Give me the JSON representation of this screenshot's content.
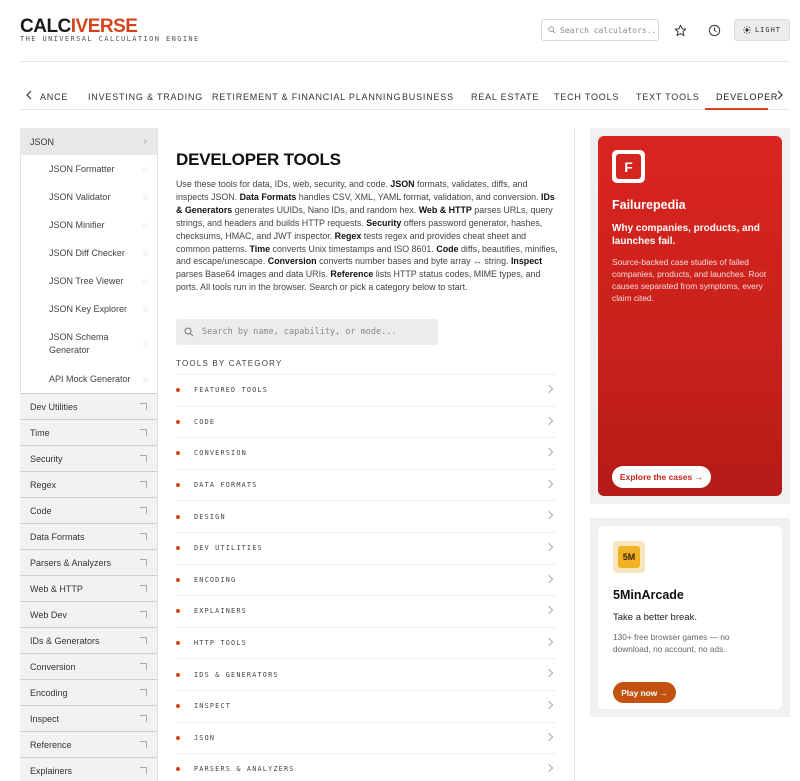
{
  "header": {
    "logo_part1": "CALC",
    "logo_part2": "IVERSE",
    "tagline": "THE UNIVERSAL CALCULATION ENGINE",
    "search_placeholder": "Search calculators...",
    "theme_label": "LIGHT",
    "icons": [
      "search-icon",
      "star-icon",
      "clock-icon",
      "sun-icon"
    ]
  },
  "tabs": {
    "items": [
      {
        "label": "ANCE"
      },
      {
        "label": "INVESTING & TRADING"
      },
      {
        "label": "RETIREMENT & FINANCIAL PLANNING"
      },
      {
        "label": "BUSINESS"
      },
      {
        "label": "REAL ESTATE"
      },
      {
        "label": "TECH TOOLS"
      },
      {
        "label": "TEXT TOOLS"
      },
      {
        "label": "DEVELOPER"
      }
    ],
    "active": "DEVELOPER"
  },
  "sidebar": {
    "open_group": "JSON",
    "open_items": [
      "JSON Formatter",
      "JSON Validator",
      "JSON Minifier",
      "JSON Diff Checker",
      "JSON Tree Viewer",
      "JSON Key Explorer",
      "JSON Schema Generator",
      "API Mock Generator"
    ],
    "groups": [
      "Dev Utilities",
      "Time",
      "Security",
      "Regex",
      "Code",
      "Data Formats",
      "Parsers & Analyzers",
      "Web & HTTP",
      "Web Dev",
      "IDs & Generators",
      "Conversion",
      "Encoding",
      "Inspect",
      "Reference",
      "Explainers"
    ]
  },
  "main": {
    "title": "DEVELOPER TOOLS",
    "description_parts": [
      {
        "t": "Use these tools for data, IDs, web, security, and code. ",
        "b": false
      },
      {
        "t": "JSON",
        "b": true
      },
      {
        "t": " formats, validates, diffs, and inspects JSON. ",
        "b": false
      },
      {
        "t": "Data Formats",
        "b": true
      },
      {
        "t": " handles CSV, XML, YAML format, validation, and conversion. ",
        "b": false
      },
      {
        "t": "IDs & Generators",
        "b": true
      },
      {
        "t": " generates UUIDs, Nano IDs, and random hex. ",
        "b": false
      },
      {
        "t": "Web & HTTP",
        "b": true
      },
      {
        "t": " parses URLs, query strings, and headers and builds HTTP requests. ",
        "b": false
      },
      {
        "t": "Security",
        "b": true
      },
      {
        "t": " offers password generator, hashes, checksums, HMAC, and JWT inspector. ",
        "b": false
      },
      {
        "t": "Regex",
        "b": true
      },
      {
        "t": " tests regex and provides cheat sheet and common patterns. ",
        "b": false
      },
      {
        "t": "Time",
        "b": true
      },
      {
        "t": " converts Unix timestamps and ISO 8601. ",
        "b": false
      },
      {
        "t": "Code",
        "b": true
      },
      {
        "t": " diffs, beautifies, minifies, and escape/unescape. ",
        "b": false
      },
      {
        "t": "Conversion",
        "b": true
      },
      {
        "t": " converts number bases and byte array ↔ string. ",
        "b": false
      },
      {
        "t": "Inspect",
        "b": true
      },
      {
        "t": " parses Base64 images and data URIs. ",
        "b": false
      },
      {
        "t": "Reference",
        "b": true
      },
      {
        "t": " lists HTTP status codes, MIME types, and ports. All tools run in the browser. Search or pick a category below to start.",
        "b": false
      }
    ],
    "search_placeholder": "Search by name, capability, or mode...",
    "categories_heading": "TOOLS BY CATEGORY",
    "categories": [
      "FEATURED TOOLS",
      "CODE",
      "CONVERSION",
      "DATA FORMATS",
      "DESIGN",
      "DEV UTILITIES",
      "ENCODING",
      "EXPLAINERS",
      "HTTP TOOLS",
      "IDS & GENERATORS",
      "INSPECT",
      "JSON",
      "PARSERS & ANALYZERS"
    ]
  },
  "ads": {
    "ad1": {
      "logo_letter": "F",
      "title": "Failurepedia",
      "headline": "Why companies, products, and launches fail.",
      "body": "Source-backed case studies of failed companies, products, and launches. Root causes separated from symptoms, every claim cited.",
      "cta": "Explore the cases →",
      "color": "#d92420"
    },
    "ad2": {
      "logo_text": "5M",
      "title": "5MinArcade",
      "headline": "Take a better break.",
      "body": "130+ free browser games — no download, no account, no ads.",
      "cta": "Play now →",
      "color": "#c3510f"
    }
  },
  "colors": {
    "accent": "#d4441c"
  }
}
